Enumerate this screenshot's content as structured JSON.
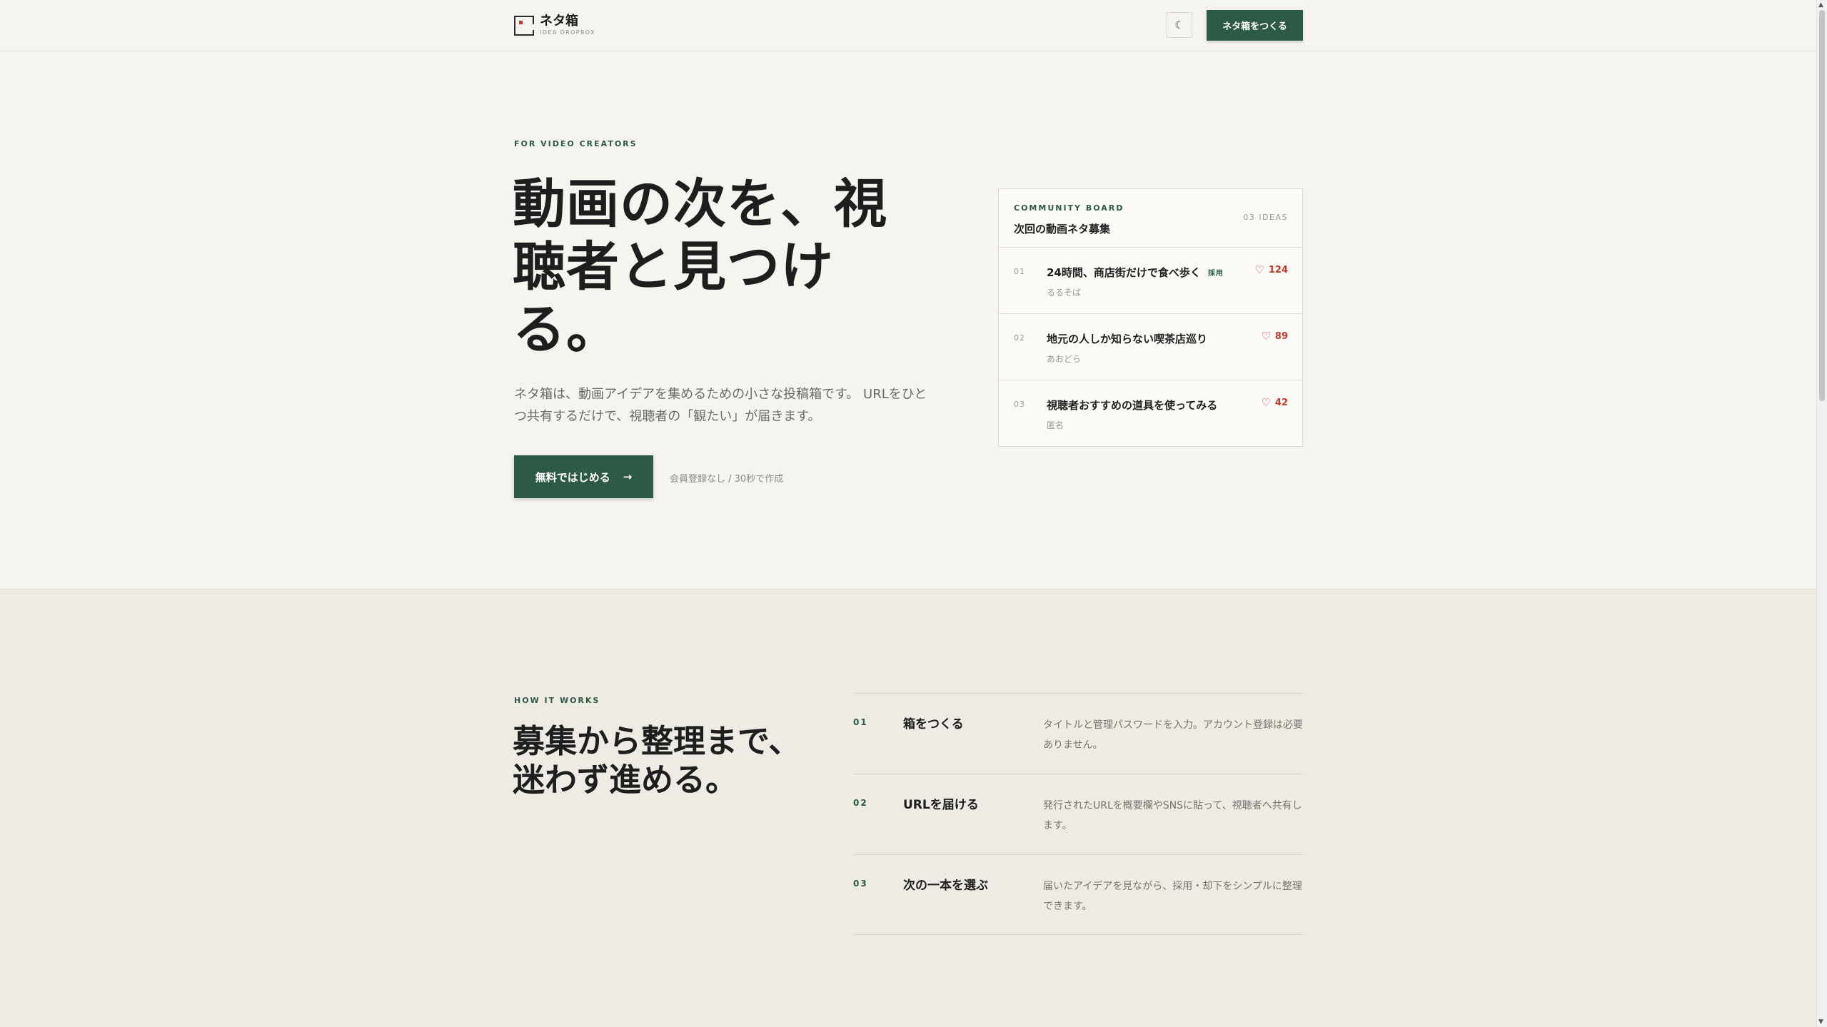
{
  "header": {
    "brand_name": "ネタ箱",
    "brand_sub": "IDEA DROPBOX",
    "theme_icon": "moon-icon",
    "cta_label": "ネタ箱をつくる"
  },
  "hero": {
    "eyebrow": "FOR VIDEO CREATORS",
    "title": "動画の次を、視聴者と見つける。",
    "description": "ネタ箱は、動画アイデアを集めるための小さな投稿箱です。 URLをひとつ共有するだけで、視聴者の「観たい」が届きます。",
    "cta_label": "無料ではじめる",
    "cta_arrow": "→",
    "cta_note": "会員登録なし / 30秒で作成"
  },
  "board": {
    "eyebrow": "COMMUNITY BOARD",
    "title": "次回の動画ネタ募集",
    "count": "03 IDEAS",
    "items": [
      {
        "num": "01",
        "title": "24時間、商店街だけで食べ歩く",
        "badge": "採用",
        "author": "るるそば",
        "likes": "124"
      },
      {
        "num": "02",
        "title": "地元の人しか知らない喫茶店巡り",
        "badge": "",
        "author": "あおどら",
        "likes": "89"
      },
      {
        "num": "03",
        "title": "視聴者おすすめの道具を使ってみる",
        "badge": "",
        "author": "匿名",
        "likes": "42"
      }
    ]
  },
  "how": {
    "eyebrow": "HOW IT WORKS",
    "title": "募集から整理まで、迷わず進める。",
    "steps": [
      {
        "num": "01",
        "title": "箱をつくる",
        "desc": "タイトルと管理パスワードを入力。アカウント登録は必要ありません。"
      },
      {
        "num": "02",
        "title": "URLを届ける",
        "desc": "発行されたURLを概要欄やSNSに貼って、視聴者へ共有します。"
      },
      {
        "num": "03",
        "title": "次の一本を選ぶ",
        "desc": "届いたアイデアを見ながら、採用・却下をシンプルに整理できます。"
      }
    ]
  },
  "colors": {
    "accent": "#2d5a45",
    "like": "#c0392b",
    "background": "#f5f4ef",
    "section_bg": "#eeebe5"
  }
}
